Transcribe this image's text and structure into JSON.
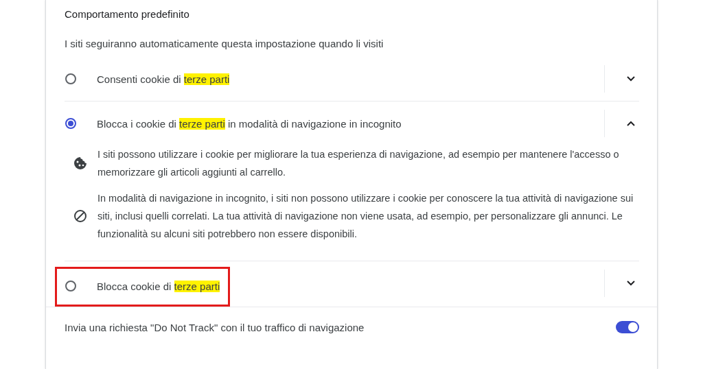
{
  "section": {
    "title": "Comportamento predefinito",
    "description": "I siti seguiranno automaticamente questa impostazione quando li visiti"
  },
  "options": [
    {
      "selected": false,
      "expanded": false,
      "outlined": false,
      "label": [
        {
          "text": "Consenti cookie di "
        },
        {
          "text": "terze parti",
          "highlighted": true
        }
      ]
    },
    {
      "selected": true,
      "expanded": true,
      "outlined": false,
      "label": [
        {
          "text": "Blocca i cookie di "
        },
        {
          "text": "terze parti",
          "highlighted": true
        },
        {
          "text": " in modalità di navigazione in incognito"
        }
      ],
      "details": [
        {
          "kind": "cookie",
          "text": "I siti possono utilizzare i cookie per migliorare la tua esperienza di navigazione, ad esempio per mantenere l'accesso o memorizzare gli articoli aggiunti al carrello."
        },
        {
          "kind": "blocked",
          "text": "In modalità di navigazione in incognito, i siti non possono utilizzare i cookie per conoscere la tua attività di navigazione sui siti, inclusi quelli correlati. La tua attività di navigazione non viene usata, ad esempio, per personalizzare gli annunci. Le funzionalità su alcuni siti potrebbero non essere disponibili."
        }
      ]
    },
    {
      "selected": false,
      "expanded": false,
      "outlined": true,
      "label": [
        {
          "text": "Blocca cookie di "
        },
        {
          "text": "terze parti",
          "highlighted": true
        }
      ]
    }
  ],
  "do_not_track": {
    "label": "Invia una richiesta \"Do Not Track\" con il tuo traffico di navigazione",
    "on": true
  }
}
